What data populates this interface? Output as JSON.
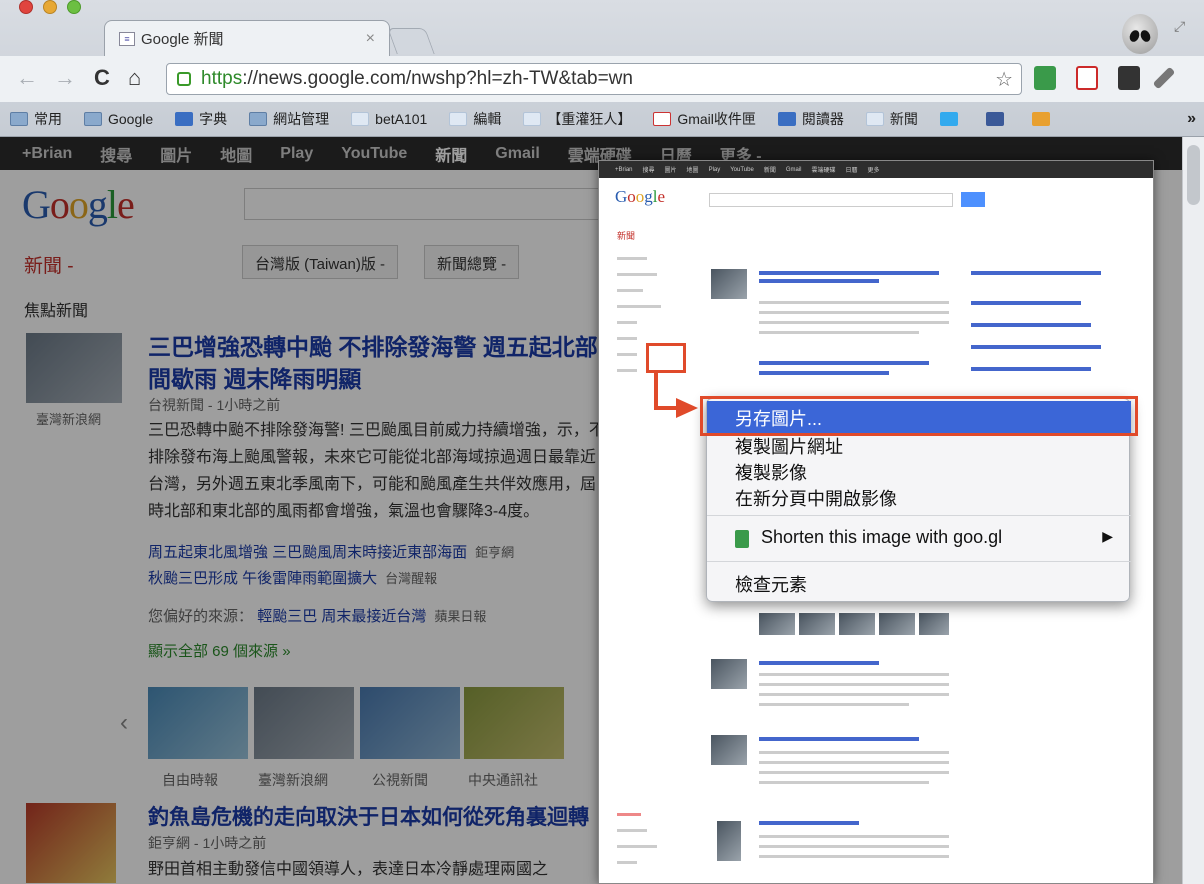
{
  "browser": {
    "tab_title": "Google 新聞",
    "tab_close": "×",
    "url_scheme": "https",
    "url_rest": "://news.google.com/nwshp?hl=zh-TW&tab=wn",
    "back": "←",
    "forward": "→",
    "reload": "C",
    "home": "⌂",
    "star": "☆",
    "bookmarks": [
      {
        "label": "常用",
        "icon": "folder"
      },
      {
        "label": "Google",
        "icon": "folder"
      },
      {
        "label": "字典",
        "icon": "blue"
      },
      {
        "label": "網站管理",
        "icon": "folder"
      },
      {
        "label": "betA101",
        "icon": "blank"
      },
      {
        "label": "編輯",
        "icon": "blank"
      },
      {
        "label": "【重灌狂人】",
        "icon": "blank"
      },
      {
        "label": "Gmail收件匣",
        "icon": "gmail"
      },
      {
        "label": "閱讀器",
        "icon": "blue"
      },
      {
        "label": "新聞",
        "icon": "blank"
      }
    ],
    "bookmarks_more": "»"
  },
  "gbar": [
    "+Brian",
    "搜尋",
    "圖片",
    "地圖",
    "Play",
    "YouTube",
    "新聞",
    "Gmail",
    "雲端硬碟",
    "日曆",
    "更多 -"
  ],
  "page": {
    "news_label": "新聞 -",
    "edition": "台灣版 (Taiwan)版 -",
    "overview": "新聞總覽 -",
    "top_stories": "焦點新聞",
    "story1": {
      "headline": "三巴增強恐轉中颱 不排除發海警 週五起北部間歇雨 週末降雨明顯",
      "meta": "台視新聞 - 1小時之前",
      "thumb_caption": "臺灣新浪網",
      "snippet": "三巴恐轉中颱不排除發海警! 三巴颱風目前威力持續增強，示，不排除發布海上颱風警報，未來它可能從北部海域掠過週日最靠近台灣，另外週五東北季風南下，可能和颱風產生共伴效應用，屆時北部和東北部的風雨都會增強，氣溫也會驟降3-4度。",
      "related": [
        {
          "text": "周五起東北風增強 三巴颱風周末時接近東部海面",
          "source": "鉅亨網"
        },
        {
          "text": "秋颱三巴形成 午後雷陣雨範圍擴大",
          "source": "台灣醒報"
        }
      ],
      "preferred_label": "您偏好的來源：",
      "preferred_link": "輕颱三巴 周末最接近台灣",
      "preferred_source": "蘋果日報",
      "more_sources": "顯示全部 69 個來源 »",
      "strip_captions": [
        "自由時報",
        "臺灣新浪網",
        "公視新聞",
        "中央通訊社"
      ]
    },
    "story2": {
      "headline": "釣魚島危機的走向取決于日本如何從死角裏迴轉",
      "meta": "鉅亨網 - 1小時之前",
      "snippet": "野田首相主動發信中國領導人，表達日本冷靜處理兩國之"
    }
  },
  "context_menu": {
    "items": [
      "另存圖片...",
      "複製圖片網址",
      "複製影像",
      "在新分頁中開啟影像",
      "Shorten this image with goo.gl",
      "檢查元素"
    ],
    "selected_index": 0,
    "submenu_arrow": "▶"
  },
  "colors": {
    "accent_red": "#e04a2a",
    "menu_selected": "#3b66d7",
    "link_blue": "#1a3aa8"
  }
}
